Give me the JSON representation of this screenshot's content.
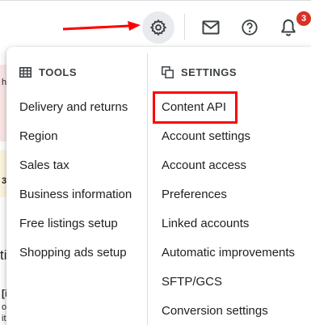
{
  "header": {
    "settings_icon": "gear-icon",
    "mail_icon": "mail-icon",
    "help_icon": "help-icon",
    "notifications_icon": "bell-icon",
    "notification_count": "3",
    "badge_color": "#d93025"
  },
  "annotation": {
    "arrow_color": "#ff0000",
    "highlight_color": "#ff0000"
  },
  "background": {
    "fragment_1": "h",
    "fragment_2": "3",
    "fragment_3": "ti",
    "fragment_4": "[i",
    "fragment_5": "o",
    "fragment_6": "it"
  },
  "menu": {
    "tools": {
      "icon": "tools-icon",
      "heading": "TOOLS",
      "items": [
        {
          "label": "Delivery and returns"
        },
        {
          "label": "Region"
        },
        {
          "label": "Sales tax"
        },
        {
          "label": "Business information"
        },
        {
          "label": "Free listings setup"
        },
        {
          "label": "Shopping ads setup"
        }
      ]
    },
    "settings": {
      "icon": "settings-copy-icon",
      "heading": "SETTINGS",
      "items": [
        {
          "label": "Content API"
        },
        {
          "label": "Account settings"
        },
        {
          "label": "Account access"
        },
        {
          "label": "Preferences"
        },
        {
          "label": "Linked accounts"
        },
        {
          "label": "Automatic improvements"
        },
        {
          "label": "SFTP/GCS"
        },
        {
          "label": "Conversion settings"
        }
      ]
    }
  }
}
